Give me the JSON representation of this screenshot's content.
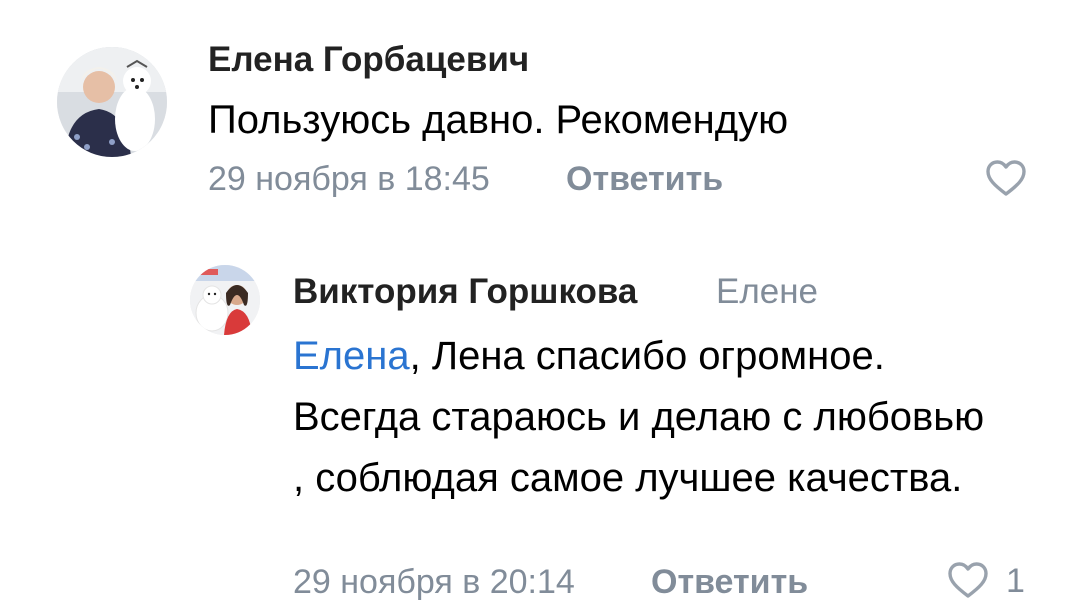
{
  "comments": [
    {
      "author": "Елена Горбацевич",
      "text": "Пользуюсь давно. Рекомендую",
      "time": "29 ноября в 18:45",
      "reply_label": "Ответить",
      "avatar_icon": "user-avatar-photo",
      "like_icon": "heart-outline-icon"
    },
    {
      "author": "Виктория Горшкова",
      "reply_to": "Елене",
      "mention": "Елена",
      "text_rest": ", Лена спасибо огромное. Всегда стараюсь и делаю с любовью , соблюдая самое лучшее качества.",
      "time": "29 ноября в 20:14",
      "reply_label": "Ответить",
      "likes": "1",
      "avatar_icon": "user-avatar-photo",
      "like_icon": "heart-outline-icon"
    }
  ],
  "colors": {
    "text": "#000000",
    "author": "#222222",
    "secondary": "#818c99",
    "link": "#2a74d1",
    "background": "#ffffff"
  }
}
